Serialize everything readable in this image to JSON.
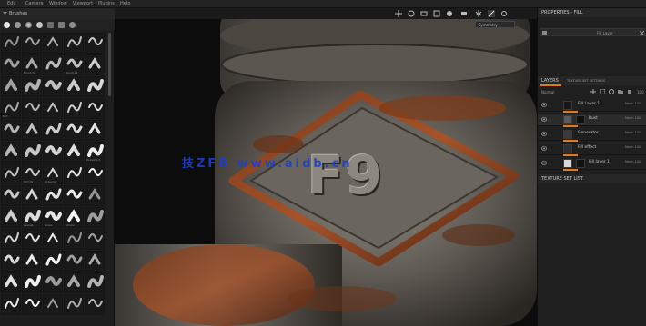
{
  "menubar": {
    "items": [
      "Edit",
      "Camera",
      "Window",
      "Viewport",
      "Plugins",
      "Help"
    ]
  },
  "shelf": {
    "title": "Brushes",
    "brush_labels": [
      [
        "",
        "",
        "",
        "",
        ""
      ],
      [
        "",
        "Brush 02",
        "",
        "Brush 04",
        ""
      ],
      [
        "",
        "",
        "",
        "",
        ""
      ],
      [
        "Dirt",
        "",
        "",
        "",
        ""
      ],
      [
        "",
        "",
        "",
        "",
        ""
      ],
      [
        "",
        "",
        "",
        "",
        "Drawing 2"
      ],
      [
        "",
        "Dirt 09",
        "Drawing",
        "",
        ""
      ],
      [
        "",
        "",
        "",
        "",
        ""
      ],
      [
        "",
        "Leaves",
        "Grass",
        "Stroke",
        ""
      ],
      [
        "",
        "",
        "",
        "",
        ""
      ],
      [
        "",
        "",
        "",
        "",
        ""
      ],
      [
        "",
        "",
        "",
        "",
        ""
      ],
      [
        "",
        "",
        "",
        "",
        ""
      ]
    ]
  },
  "viewport": {
    "tooltip": "Symmetry",
    "watermark": "技ZFB www.aidb.cn",
    "stamp_text": "F9"
  },
  "properties": {
    "title": "PROPERTIES - FILL",
    "field_label": "Fill Layer"
  },
  "layers": {
    "tab_active": "LAYERS",
    "tab_other": "TEXTURE SET SETTINGS",
    "blend_mode": "Normal",
    "opacity": "100",
    "rows": [
      {
        "name": "Fill Layer 1",
        "meta": "Norm 100",
        "thumb_color": "#161616",
        "has_mask": false
      },
      {
        "name": "Rust",
        "meta": "Norm 100",
        "thumb_color": "#5a5a5a",
        "has_mask": true
      },
      {
        "name": "Generator",
        "meta": "Norm 100",
        "thumb_color": "#3b3b3b",
        "has_mask": false
      },
      {
        "name": "Fill effect",
        "meta": "Norm 100",
        "thumb_color": "#2d2d2d",
        "has_mask": false
      },
      {
        "name": "Fill layer 1",
        "meta": "Norm 100",
        "thumb_color": "#d8d8d8",
        "has_mask": true
      }
    ]
  },
  "texture_set_list": {
    "title": "TEXTURE SET LIST"
  },
  "colors": {
    "accent": "#e07a1f",
    "panel": "#1f1f1f",
    "watermark": "#1f3fc9"
  }
}
